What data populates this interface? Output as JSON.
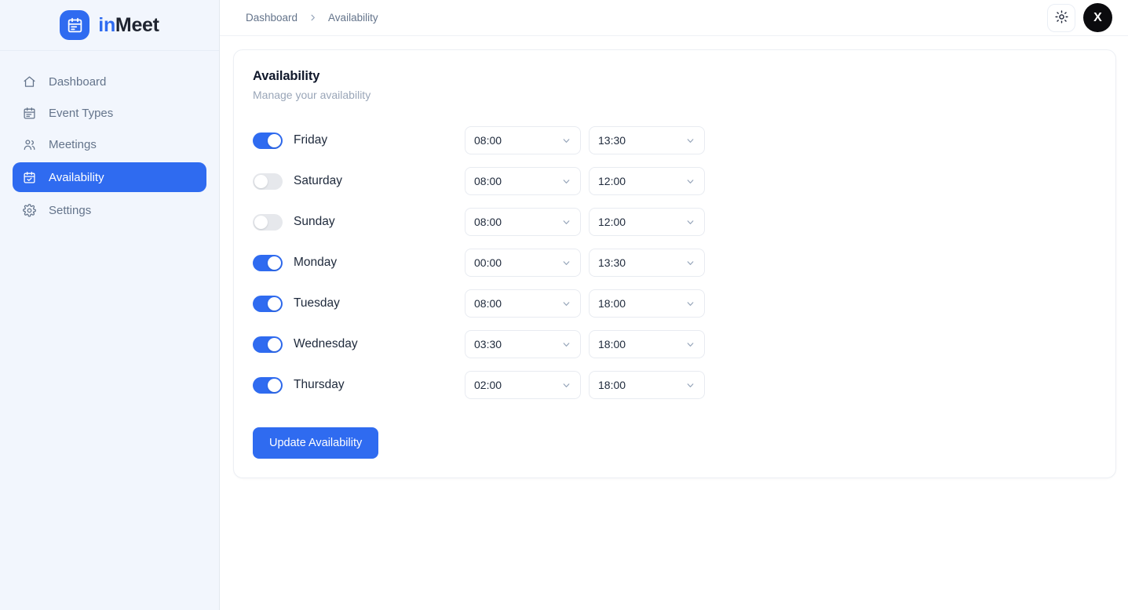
{
  "brand": {
    "name_prefix": "in",
    "name_suffix": "Meet",
    "logo_icon": "calendar-icon",
    "accent_color": "#2f6bf0"
  },
  "sidebar": {
    "items": [
      {
        "label": "Dashboard",
        "icon": "home-icon",
        "active": false
      },
      {
        "label": "Event Types",
        "icon": "calendar-icon",
        "active": false
      },
      {
        "label": "Meetings",
        "icon": "users-icon",
        "active": false
      },
      {
        "label": "Availability",
        "icon": "calendar-check-icon",
        "active": true
      },
      {
        "label": "Settings",
        "icon": "gear-icon",
        "active": false
      }
    ]
  },
  "topbar": {
    "breadcrumb": [
      {
        "label": "Dashboard"
      },
      {
        "label": "Availability"
      }
    ],
    "separator": "›",
    "theme_toggle_icon": "sun-icon",
    "avatar_initial": "X"
  },
  "card": {
    "title": "Availability",
    "subtitle": "Manage your availability",
    "update_button": "Update Availability",
    "days": [
      {
        "day": "Friday",
        "enabled": true,
        "start": "08:00",
        "end": "13:30"
      },
      {
        "day": "Saturday",
        "enabled": false,
        "start": "08:00",
        "end": "12:00"
      },
      {
        "day": "Sunday",
        "enabled": false,
        "start": "08:00",
        "end": "12:00"
      },
      {
        "day": "Monday",
        "enabled": true,
        "start": "00:00",
        "end": "13:30"
      },
      {
        "day": "Tuesday",
        "enabled": true,
        "start": "08:00",
        "end": "18:00"
      },
      {
        "day": "Wednesday",
        "enabled": true,
        "start": "03:30",
        "end": "18:00"
      },
      {
        "day": "Thursday",
        "enabled": true,
        "start": "02:00",
        "end": "18:00"
      }
    ]
  }
}
